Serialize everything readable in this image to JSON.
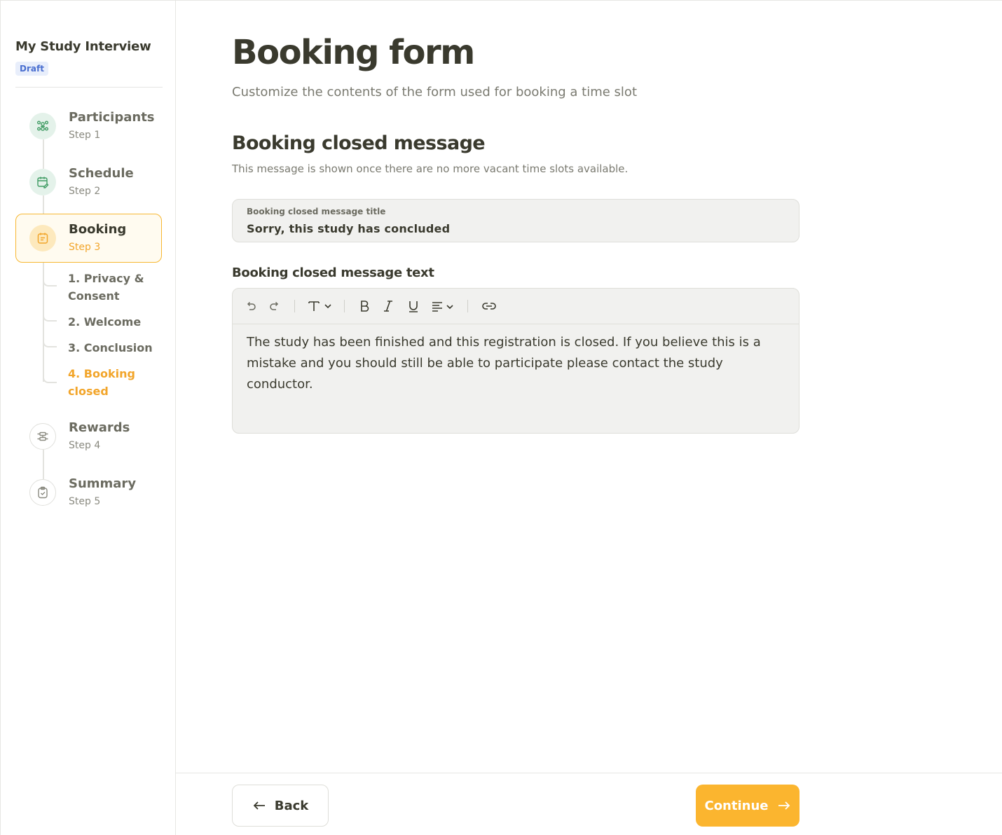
{
  "sidebar": {
    "study_title": "My Study Interview",
    "status_badge": "Draft",
    "steps": [
      {
        "title": "Participants",
        "subtitle": "Step 1",
        "icon": "participants-icon",
        "state": "done"
      },
      {
        "title": "Schedule",
        "subtitle": "Step 2",
        "icon": "calendar-edit-icon",
        "state": "done"
      },
      {
        "title": "Booking",
        "subtitle": "Step 3",
        "icon": "booking-icon",
        "state": "current"
      },
      {
        "title": "Rewards",
        "subtitle": "Step 4",
        "icon": "rewards-icon",
        "state": "todo"
      },
      {
        "title": "Summary",
        "subtitle": "Step 5",
        "icon": "clipboard-check-icon",
        "state": "todo"
      }
    ],
    "substeps": [
      {
        "label_line1": "1. Privacy &",
        "label_line2": "Consent"
      },
      {
        "label_line1": "2. Welcome"
      },
      {
        "label_line1": "3. Conclusion"
      },
      {
        "label_line1": "4. Booking",
        "label_line2": "closed",
        "active": true
      }
    ]
  },
  "main": {
    "title": "Booking form",
    "subtitle": "Customize the contents of the form used for booking a time slot",
    "section": {
      "title": "Booking closed message",
      "description": "This message is shown once there are no more vacant time slots available."
    },
    "title_field": {
      "label": "Booking closed message title",
      "value": "Sorry, this study has concluded"
    },
    "editor": {
      "label": "Booking closed message text",
      "toolbar": [
        "undo-icon",
        "redo-icon",
        "text-style-icon",
        "bold-icon",
        "italic-icon",
        "underline-icon",
        "align-icon",
        "link-icon"
      ],
      "content": "The study has been finished and this registration is closed. If you believe this is a mistake and you should still be able to participate please contact the study conductor."
    }
  },
  "footer": {
    "back_label": "Back",
    "continue_label": "Continue"
  },
  "colors": {
    "accent": "#fbb52f",
    "accent_text": "#f2a52a",
    "done_green": "#3f9b63",
    "draft_blue": "#4a6fd0"
  }
}
